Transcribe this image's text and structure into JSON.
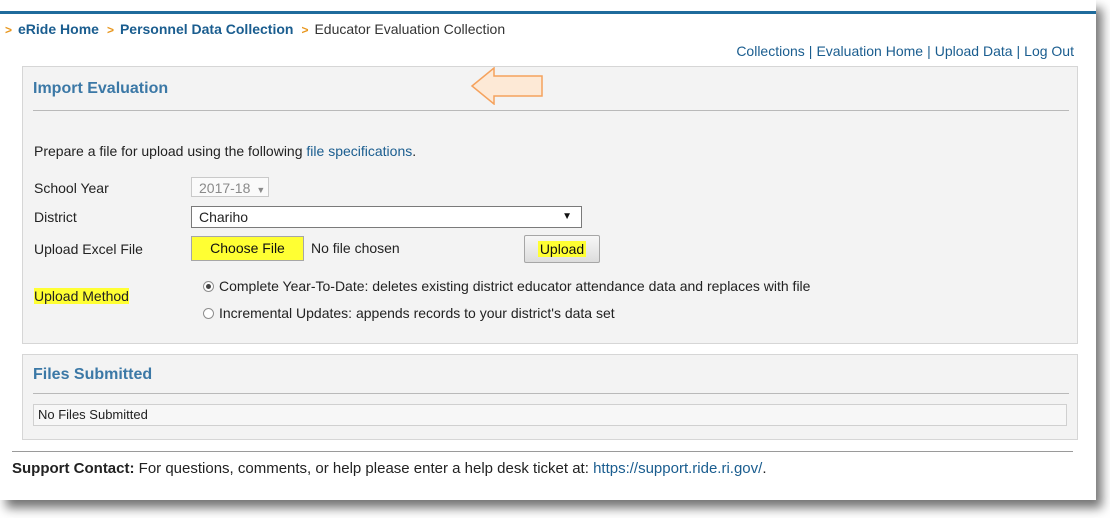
{
  "breadcrumb": {
    "items": [
      "eRide Home",
      "Personnel Data Collection"
    ],
    "current": "Educator Evaluation Collection",
    "separator": ">"
  },
  "top_links": [
    "Collections",
    "Evaluation Home",
    "Upload Data",
    "Log Out"
  ],
  "import_panel": {
    "title": "Import Evaluation",
    "prepare_text": "Prepare a file for upload using the following",
    "spec_link": "file specifications",
    "spec_link_suffix": ".",
    "school_year_label": "School Year",
    "school_year_value": "2017-18",
    "district_label": "District",
    "district_value": "Chariho",
    "upload_file_label": "Upload Excel File",
    "choose_file_label": "Choose File",
    "no_file_text": "No file chosen",
    "upload_button": "Upload",
    "upload_method_label": "Upload Method",
    "methods": [
      {
        "label": "Complete Year-To-Date: deletes existing district educator attendance data and replaces with file",
        "selected": true
      },
      {
        "label": "Incremental Updates: appends records to your district's data set",
        "selected": false
      }
    ]
  },
  "files_panel": {
    "title": "Files Submitted",
    "empty_text": "No Files Submitted"
  },
  "support": {
    "label": "Support Contact:",
    "text": "For questions, comments, or help please enter a help desk ticket at:",
    "link": "https://support.ride.ri.gov/",
    "suffix": "."
  },
  "colors": {
    "link": "#1a5d8f",
    "panel_title": "#3b78a6",
    "highlight": "#ffff33",
    "accent_arrow": "#f5a25d",
    "top_border": "#1f6b9c"
  },
  "icons": {
    "breadcrumb_separator": "chevron-right-icon",
    "select_caret": "caret-down-icon",
    "annotation": "left-arrow-icon"
  }
}
